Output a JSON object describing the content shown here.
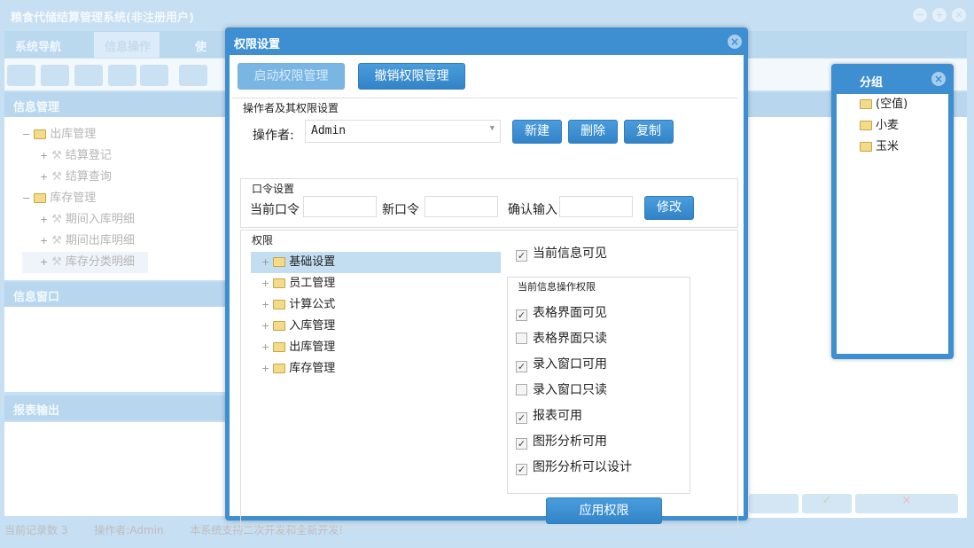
{
  "app": {
    "title": "粮食代储结算管理系统(非注册用户)",
    "tabs": [
      "系统导航",
      "信息操作",
      "使"
    ],
    "panels": {
      "info_mgmt": "信息管理",
      "info_window": "信息窗口",
      "report_output": "报表输出"
    },
    "tree": [
      {
        "label": "出库管理",
        "level": 0
      },
      {
        "label": "结算登记",
        "level": 1
      },
      {
        "label": "结算查询",
        "level": 1
      },
      {
        "label": "库存管理",
        "level": 0
      },
      {
        "label": "期间入库明细",
        "level": 1
      },
      {
        "label": "期间出库明细",
        "level": 1
      },
      {
        "label": "库存分类明细",
        "level": 1
      }
    ],
    "status": {
      "records": "当前记录数 3",
      "operator": "操作者:Admin",
      "note": "本系统支持二次开发和全新开发!"
    }
  },
  "dialog": {
    "title": "权限设置",
    "enable_btn": "启动权限管理",
    "revoke_btn": "撤销权限管理",
    "operator_section": "操作者及其权限设置",
    "operator_label": "操作者:",
    "operator_value": "Admin",
    "new_btn": "新建",
    "delete_btn": "删除",
    "copy_btn": "复制",
    "password_section": "口令设置",
    "current_pw": "当前口令",
    "new_pw": "新口令",
    "confirm_pw": "确认输入",
    "modify_btn": "修改",
    "perm_section": "权限",
    "perm_tree": [
      "基础设置",
      "员工管理",
      "计算公式",
      "入库管理",
      "出库管理",
      "库存管理"
    ],
    "visible_label": "当前信息可见",
    "visible_checked": true,
    "ops_section": "当前信息操作权限",
    "ops": [
      {
        "label": "表格界面可见",
        "checked": true
      },
      {
        "label": "表格界面只读",
        "checked": false
      },
      {
        "label": "录入窗口可用",
        "checked": true
      },
      {
        "label": "录入窗口只读",
        "checked": false
      },
      {
        "label": "报表可用",
        "checked": true
      },
      {
        "label": "图形分析可用",
        "checked": true
      },
      {
        "label": "图形分析可以设计",
        "checked": true
      }
    ],
    "apply_btn": "应用权限"
  },
  "group": {
    "title": "分组",
    "items": [
      "(空值)",
      "小麦",
      "玉米"
    ]
  }
}
